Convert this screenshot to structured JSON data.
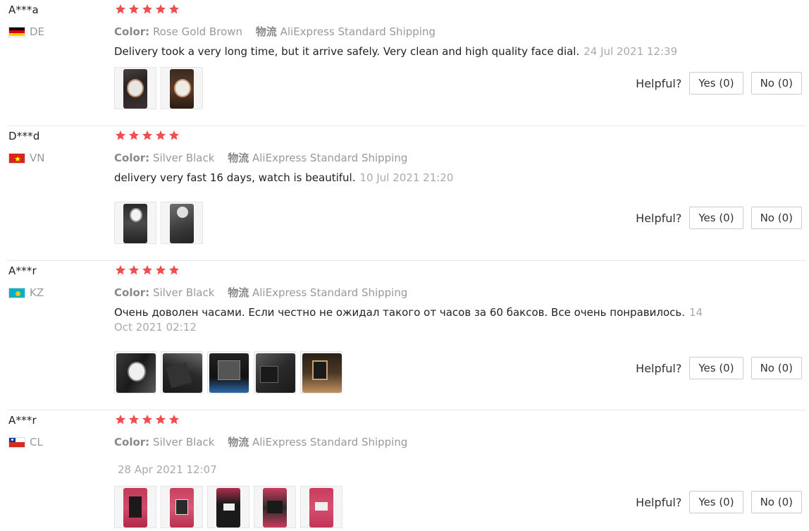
{
  "reviews": [
    {
      "user": "A***a",
      "country": "DE",
      "flag": "de",
      "stars": 5,
      "color_label": "Color:",
      "color_value": "Rose Gold Brown",
      "shipping_label": "物流",
      "shipping_value": "AliExpress Standard Shipping",
      "text": "Delivery took a very long time, but it arrive safely. Very clean and high quality face dial.",
      "date": "24 Jul 2021 12:39",
      "photos": [
        "watch-photo",
        "watch-photo"
      ],
      "helpful_label": "Helpful?",
      "yes_label": "Yes (0)",
      "no_label": "No (0)"
    },
    {
      "user": "D***d",
      "country": "VN",
      "flag": "vn",
      "stars": 5,
      "color_label": "Color:",
      "color_value": "Silver Black",
      "shipping_label": "物流",
      "shipping_value": "AliExpress Standard Shipping",
      "text": "delivery very fast 16 days, watch is beautiful.",
      "date": "10 Jul 2021 21:20",
      "photos": [
        "watch-photo",
        "watch-photo"
      ],
      "helpful_label": "Helpful?",
      "yes_label": "Yes (0)",
      "no_label": "No (0)"
    },
    {
      "user": "A***r",
      "country": "KZ",
      "flag": "kz",
      "stars": 5,
      "color_label": "Color:",
      "color_value": "Silver Black",
      "shipping_label": "物流",
      "shipping_value": "AliExpress Standard Shipping",
      "text": "Очень доволен часами. Если честно не ожидал такого от часов за 60 баксов. Все очень понравилось.",
      "date": "14 Oct 2021 02:12",
      "photos": [
        "watch-photo",
        "box-photo",
        "box-photo",
        "box-photo",
        "watch-photo"
      ],
      "helpful_label": "Helpful?",
      "yes_label": "Yes (0)",
      "no_label": "No (0)"
    },
    {
      "user": "A***r",
      "country": "CL",
      "flag": "cl",
      "stars": 5,
      "color_label": "Color:",
      "color_value": "Silver Black",
      "shipping_label": "物流",
      "shipping_value": "AliExpress Standard Shipping",
      "text": "",
      "date": "28 Apr 2021 12:07",
      "photos": [
        "box-photo",
        "box-photo",
        "box-photo",
        "box-photo",
        "box-photo"
      ],
      "helpful_label": "Helpful?",
      "yes_label": "Yes (0)",
      "no_label": "No (0)"
    }
  ],
  "colors": {
    "star": "#f04e4e",
    "muted_text": "#999999",
    "border": "#cccccc"
  }
}
